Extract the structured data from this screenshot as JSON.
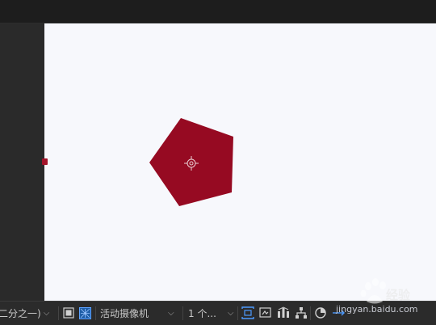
{
  "viewer": {
    "shape": "pentagon",
    "shape_color": "#960a22",
    "canvas_color": "#f7f8fc"
  },
  "bottom_bar": {
    "resolution_label": "二分之一)",
    "camera_label": "活动摄像机",
    "views_label": "1 个...",
    "icons": [
      "region-of-interest-icon",
      "transparency-grid-icon",
      "view-layout-icon",
      "snapshot-icon",
      "flowchart-icon",
      "network-icon",
      "reset-exposure-icon",
      "exposure-icon"
    ]
  },
  "watermark": {
    "url_text": "jingyan.baidu.com",
    "cn_text": "经验"
  }
}
